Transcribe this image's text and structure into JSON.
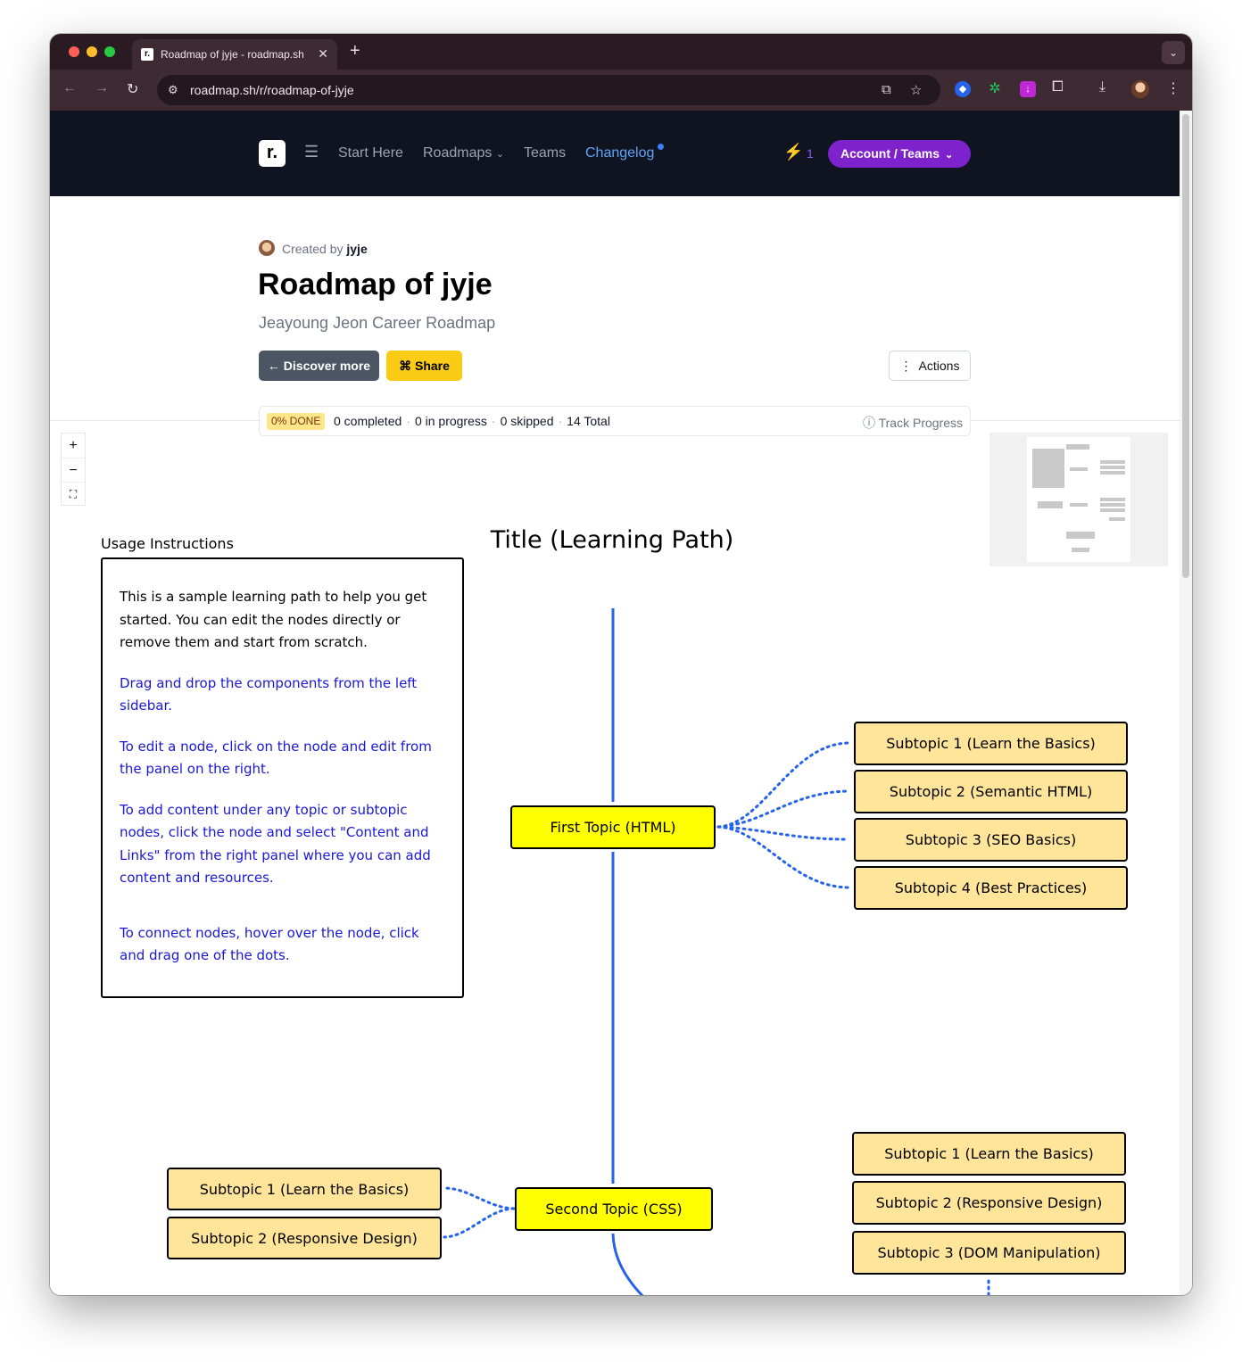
{
  "browser": {
    "tab_title": "Roadmap of jyje - roadmap.sh",
    "tab_favicon": "r.",
    "url": "roadmap.sh/r/roadmap-of-jyje",
    "icons": [
      "back-icon",
      "forward-icon",
      "reload-icon",
      "site-settings-icon",
      "install-icon",
      "bookmark-star-icon",
      "extension-icon",
      "downloads-icon",
      "profile-avatar",
      "more-vert-icon"
    ]
  },
  "header": {
    "logo": "r.",
    "nav": {
      "start_here": "Start Here",
      "roadmaps": "Roadmaps",
      "teams": "Teams",
      "changelog": "Changelog"
    },
    "streak_count": "1",
    "account_label": "Account / Teams",
    "colors": {
      "background": "#0f1420",
      "account": "#7e22ce",
      "changelog": "#60a5fa"
    }
  },
  "roadmap": {
    "created_by_prefix": "Created by",
    "author": "jyje",
    "title": "Roadmap of jyje",
    "subtitle": "Jeayoung Jeon Career Roadmap",
    "discover_label": "← Discover more",
    "share_label": "Share",
    "actions_label": "Actions"
  },
  "progress": {
    "done_badge": "0% DONE",
    "completed": "0 completed",
    "in_progress": "0 in progress",
    "skipped": "0 skipped",
    "total": "14 Total",
    "track_label": "Track Progress",
    "sep": "·"
  },
  "zoom": {
    "in": "+",
    "out": "−",
    "fit": "⛶"
  },
  "canvas": {
    "usage_label": "Usage Instructions",
    "usage_intro": "This is a sample learning path to help you get started. You can edit the nodes directly or remove them and start from scratch.",
    "usage_drag": "Drag and drop the components from the left sidebar.",
    "usage_edit": "To edit a node, click on the node and edit from the panel on the right.",
    "usage_content": "To add content under any topic or subtopic nodes, click the node and select \"Content and Links\" from the right panel where you can add content and resources.",
    "usage_connect": "To connect nodes, hover over the node, click and drag one of the dots.",
    "title": "Title (Learning Path)",
    "topic1": "First Topic (HTML)",
    "topic1_subs": [
      "Subtopic 1 (Learn the Basics)",
      "Subtopic 2 (Semantic HTML)",
      "Subtopic 3 (SEO Basics)",
      "Subtopic 4 (Best Practices)"
    ],
    "topic2": "Second Topic (CSS)",
    "topic2_left_subs": [
      "Subtopic 1 (Learn the Basics)",
      "Subtopic 2 (Responsive Design)"
    ],
    "right_subs": [
      "Subtopic 1 (Learn the Basics)",
      "Subtopic 2 (Responsive Design)",
      "Subtopic 3 (DOM Manipulation)"
    ],
    "colors": {
      "topic": "#ffff00",
      "subtopic": "#ffe599",
      "edge": "#2563eb",
      "instruction_text": "#1a17d6"
    }
  }
}
